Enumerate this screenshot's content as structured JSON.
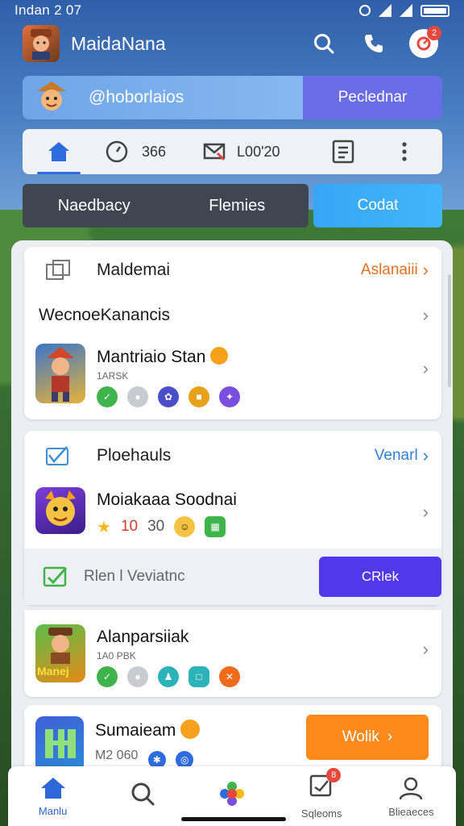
{
  "status_bar": {
    "time": "Indan 2 07"
  },
  "header": {
    "title": "MaidaNana",
    "notification_count": "2"
  },
  "profile": {
    "handle": "@hoborlaios",
    "button": "Peclednar"
  },
  "quick_bar": {
    "stat1": "366",
    "stat2": "L00'20"
  },
  "segment": {
    "tab1": "Naedbacy",
    "tab2": "Flemies",
    "cta": "Codat"
  },
  "card1": {
    "title": "Maldemai",
    "link": "Aslanaiii",
    "subtitle": "WecnoeKanancis",
    "game_title": "Mantriaio Stan",
    "game_meta": "1ARSK"
  },
  "card2": {
    "title": "Ploehauls",
    "link": "Venarl",
    "game_title": "Moiakaaa Soodnai",
    "game_rating_a": "10",
    "game_rating_b": "30",
    "footer_label": "Rlen l Veviatnc",
    "footer_button": "CRlek"
  },
  "card3": {
    "game_title": "Alanparsiiak",
    "game_meta": "1A0 PBK",
    "thumb_label": "Manej"
  },
  "card4": {
    "game_title": "Sumaieam",
    "game_meta": "M2 060",
    "button": "Wolik"
  },
  "bottom_nav": {
    "items": [
      {
        "label": "Manlu"
      },
      {
        "label": ""
      },
      {
        "label": ""
      },
      {
        "label": "Sqleoms",
        "badge": "8"
      },
      {
        "label": "Blieaeces"
      }
    ]
  },
  "colors": {
    "accent_blue": "#2e67d8",
    "purple_button": "#5138ea",
    "orange_button": "#ff8a1c",
    "link_orange": "#e5711c",
    "link_blue": "#2f7fd8",
    "cta_blue": "#3aa9f7"
  }
}
